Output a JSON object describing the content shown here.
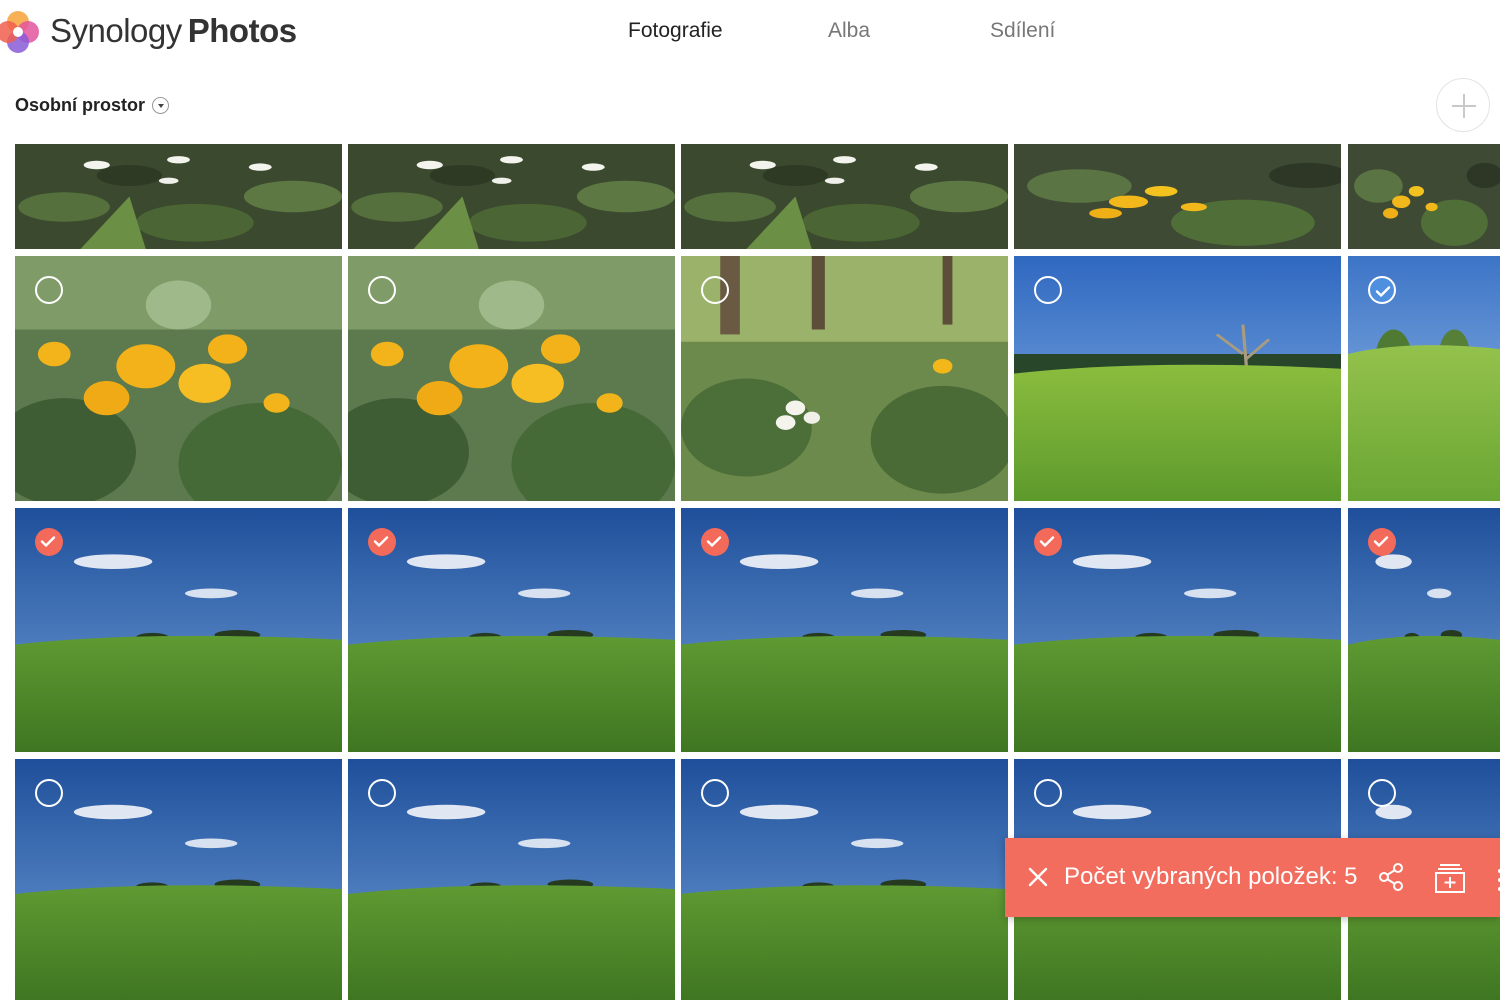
{
  "app": {
    "brand_light": "Synology",
    "brand_bold": "Photos"
  },
  "nav": {
    "tabs": [
      "Fotografie",
      "Alba",
      "Sdílení"
    ],
    "active_index": 0
  },
  "space": {
    "label": "Osobní prostor"
  },
  "colors": {
    "accent": "#f26d5e",
    "check_red": "#f36a5a",
    "check_blue": "#4f8fe0"
  },
  "icons": {
    "logo": "synology-photos-logo-icon",
    "add": "plus-icon",
    "caret": "chevron-down-icon",
    "close": "close-icon",
    "share": "share-icon",
    "add_album": "add-to-album-icon",
    "more": "more-icon"
  },
  "selection_bar": {
    "count_text": "Počet vybraných položek: 5"
  },
  "photos": [
    {
      "scene": "flowers-white",
      "selection": "none"
    },
    {
      "scene": "flowers-white",
      "selection": "none"
    },
    {
      "scene": "flowers-white",
      "selection": "none"
    },
    {
      "scene": "flowers-yellow",
      "selection": "none"
    },
    {
      "scene": "flowers-yellow",
      "selection": "none"
    },
    {
      "scene": "flowers-yellow-big",
      "selection": "empty"
    },
    {
      "scene": "flowers-yellow-big",
      "selection": "empty"
    },
    {
      "scene": "forest-meadow",
      "selection": "empty"
    },
    {
      "scene": "field-tree",
      "selection": "empty"
    },
    {
      "scene": "field-hill",
      "selection": "checked-blue"
    },
    {
      "scene": "field-sky",
      "selection": "checked"
    },
    {
      "scene": "field-sky",
      "selection": "checked"
    },
    {
      "scene": "field-sky",
      "selection": "checked"
    },
    {
      "scene": "field-sky",
      "selection": "checked"
    },
    {
      "scene": "field-sky",
      "selection": "checked"
    },
    {
      "scene": "field-sky",
      "selection": "empty"
    },
    {
      "scene": "field-sky",
      "selection": "empty"
    },
    {
      "scene": "field-sky",
      "selection": "empty"
    },
    {
      "scene": "field-sky",
      "selection": "empty"
    },
    {
      "scene": "field-sky",
      "selection": "empty"
    }
  ]
}
